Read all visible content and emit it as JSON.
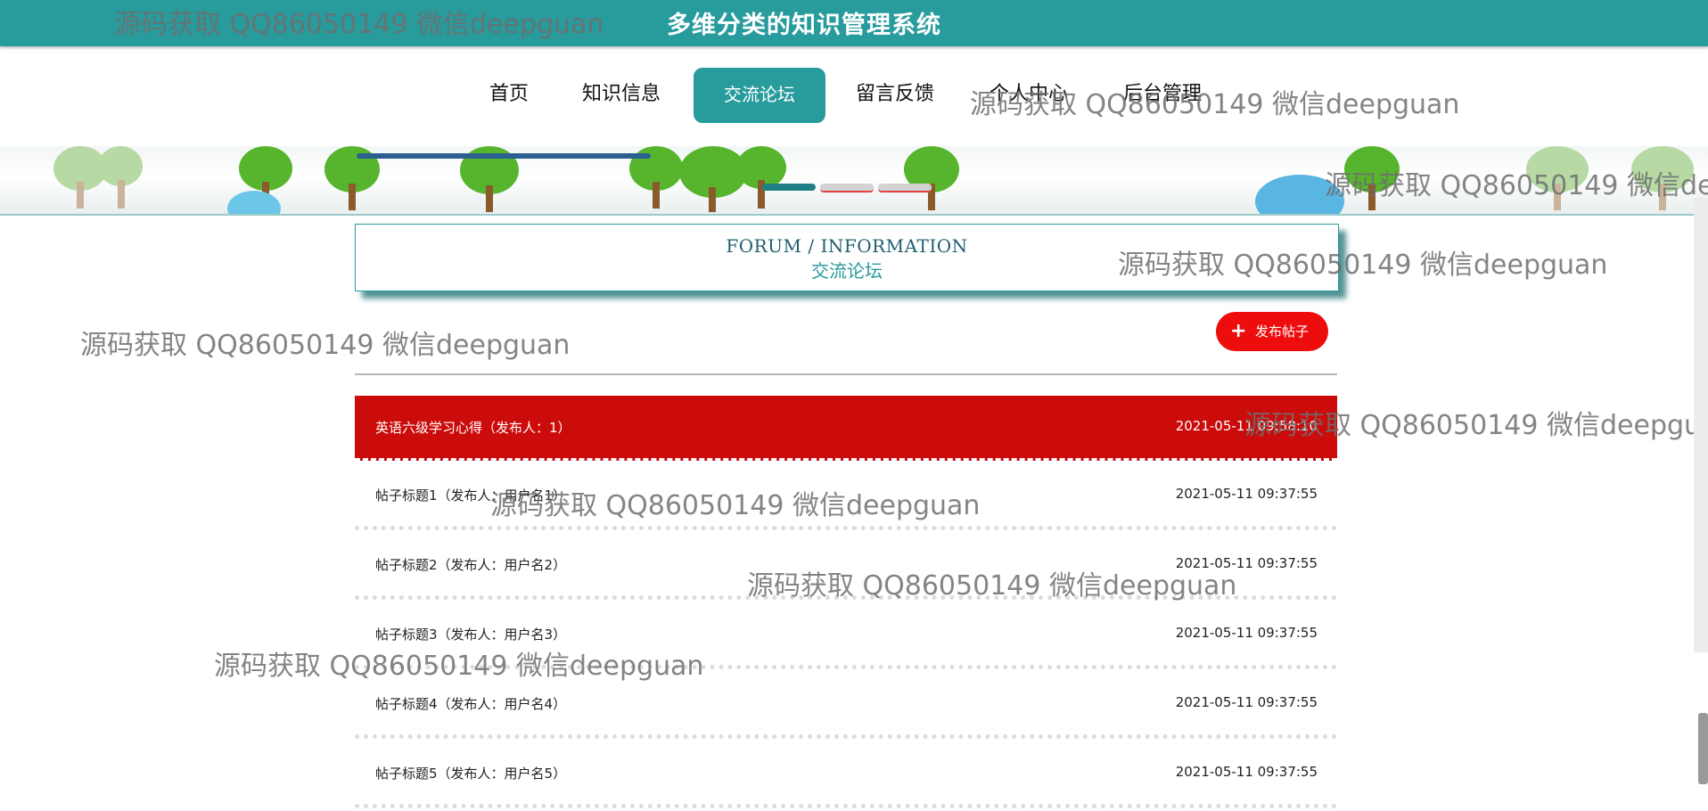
{
  "header": {
    "title": "多维分类的知识管理系统"
  },
  "nav": {
    "items": [
      {
        "label": "首页"
      },
      {
        "label": "知识信息"
      },
      {
        "label": "交流论坛",
        "active": true
      },
      {
        "label": "留言反馈"
      },
      {
        "label": "个人中心"
      },
      {
        "label": "后台管理"
      }
    ]
  },
  "section": {
    "title_en": "FORUM / INFORMATION",
    "title_zh": "交流论坛"
  },
  "actions": {
    "publish_label": "发布帖子",
    "publish_icon": "plus-icon"
  },
  "posts": [
    {
      "title": "英语六级学习心得（发布人：1）",
      "date": "2021-05-11 09:58:10",
      "highlighted": true
    },
    {
      "title": "帖子标题1（发布人：用户名1）",
      "date": "2021-05-11 09:37:55"
    },
    {
      "title": "帖子标题2（发布人：用户名2）",
      "date": "2021-05-11 09:37:55"
    },
    {
      "title": "帖子标题3（发布人：用户名3）",
      "date": "2021-05-11 09:37:55"
    },
    {
      "title": "帖子标题4（发布人：用户名4）",
      "date": "2021-05-11 09:37:55"
    },
    {
      "title": "帖子标题5（发布人：用户名5）",
      "date": "2021-05-11 09:37:55"
    }
  ],
  "watermark": {
    "text": "源码获取 QQ86050149 微信deepguan"
  },
  "colors": {
    "primary": "#289b9d",
    "highlight": "#cc0b0b",
    "button": "#ee0d0d"
  }
}
